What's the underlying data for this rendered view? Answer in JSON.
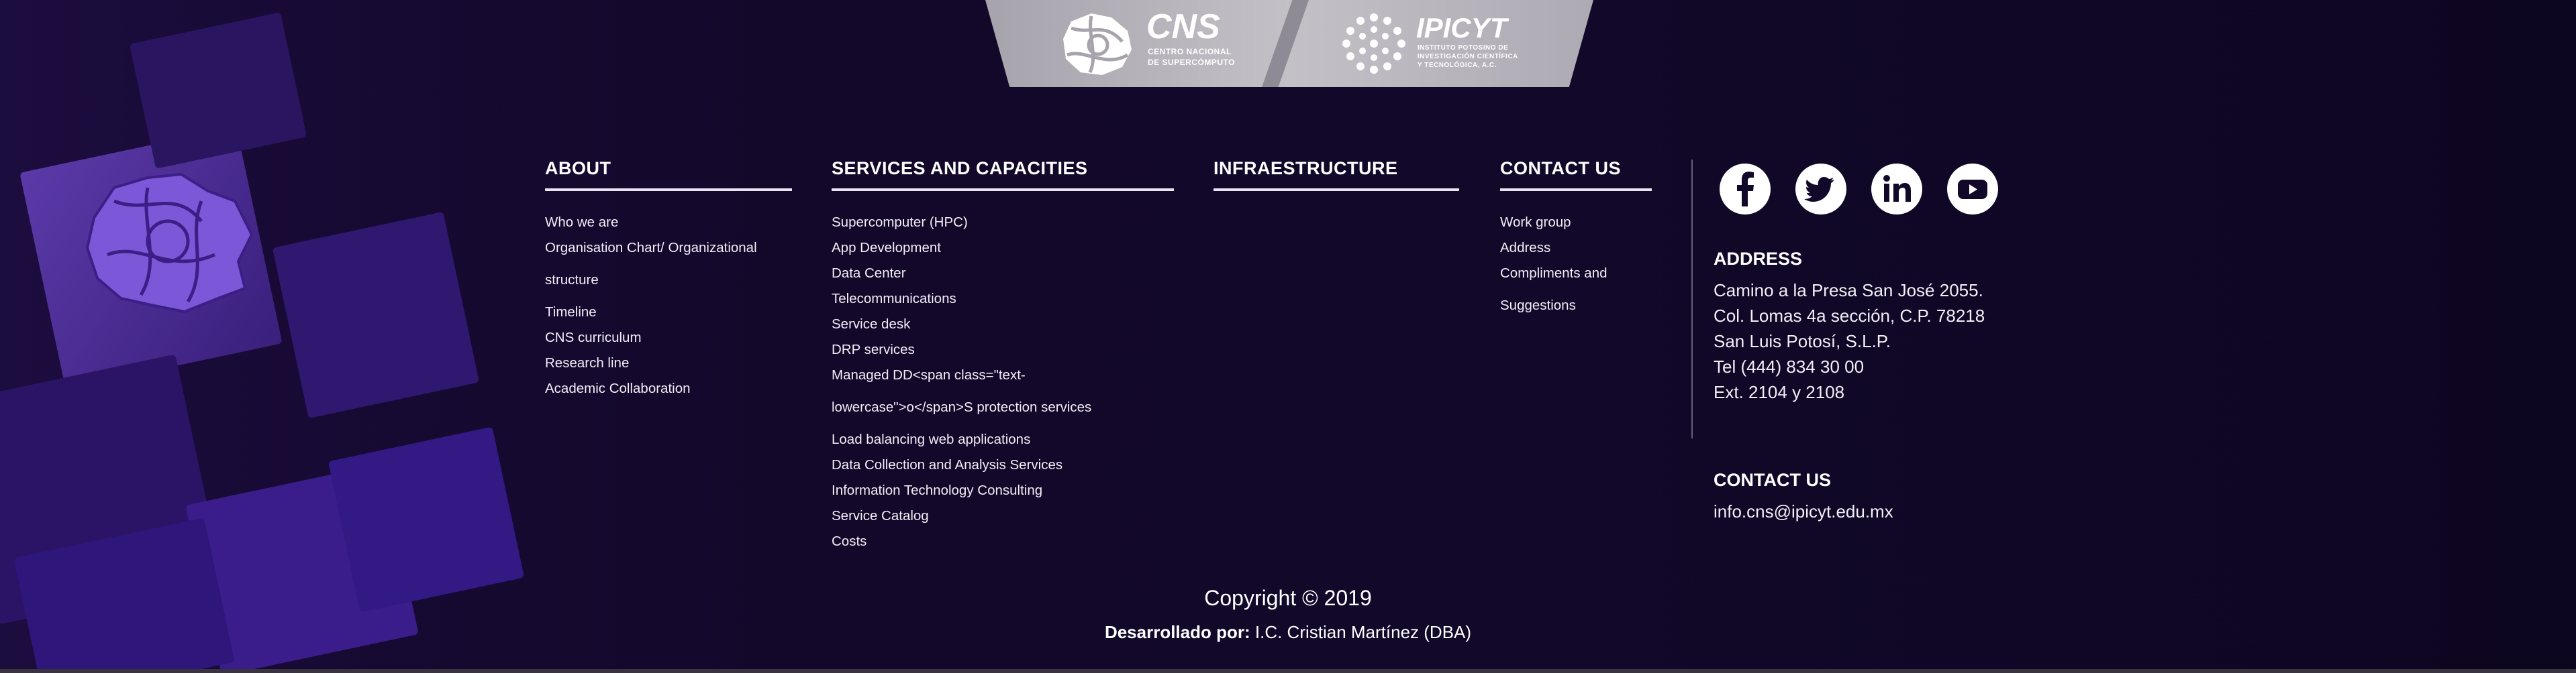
{
  "logos": {
    "cns": {
      "name": "CNS",
      "sub1": "CENTRO NACIONAL",
      "sub2": "DE SUPERCÓMPUTO"
    },
    "ipicyt": {
      "name": "IPICYT",
      "sub1": "INSTITUTO POTOSINO DE",
      "sub2": "INVESTIGACIÓN CIENTÍFICA",
      "sub3": "Y TECNOLÓGICA, A.C."
    }
  },
  "about": {
    "title": "ABOUT",
    "items": [
      "Who we are",
      "Organisation Chart/ Organizational",
      "structure",
      "Timeline",
      "CNS curriculum",
      "Research line",
      "Academic Collaboration"
    ]
  },
  "services": {
    "title": "SERVICES AND CAPACITIES",
    "items": [
      "Supercomputer (HPC)",
      "App Development",
      "Data Center",
      "Telecommunications",
      "Service desk",
      "DRP services",
      "Managed DD<span class=\"text-",
      "lowercase\">o</span>S protection services",
      "Load balancing web applications",
      "Data Collection and Analysis Services",
      "Information Technology Consulting",
      "Service Catalog",
      "Costs"
    ]
  },
  "infra": {
    "title": "INFRAESTRUCTURE"
  },
  "contact_col": {
    "title": "CONTACT US",
    "items": [
      "Work group",
      "Address",
      "Compliments and",
      "Suggestions"
    ]
  },
  "social": [
    "facebook-icon",
    "twitter-icon",
    "linkedin-icon",
    "youtube-icon"
  ],
  "address": {
    "title": "ADDRESS",
    "lines": [
      "Camino a la Presa San José 2055.",
      "Col. Lomas 4a sección, C.P. 78218",
      "San Luis Potosí, S.L.P.",
      "Tel (444) 834 30 00",
      "Ext. 2104 y 2108"
    ]
  },
  "contact": {
    "title": "CONTACT US",
    "email": "info.cns@ipicyt.edu.mx"
  },
  "footer": {
    "copyright": "Copyright © 2019",
    "developed_label": "Desarrollado por:",
    "developer": " I.C. Cristian Martínez (DBA)"
  },
  "colors": {
    "background": "#13082a",
    "accent_purple": "#5a2fb0",
    "logo_bar": "#b9b5bd"
  }
}
